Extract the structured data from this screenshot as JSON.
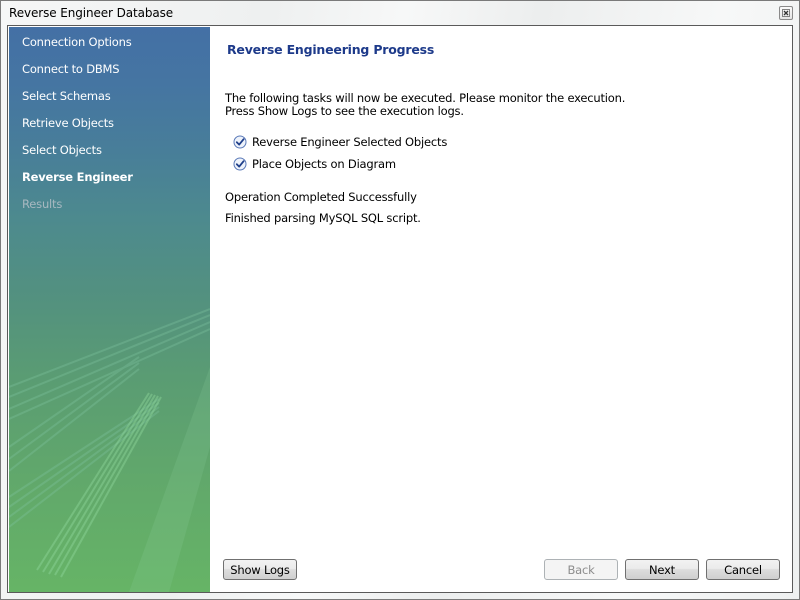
{
  "window": {
    "title": "Reverse Engineer Database",
    "close_icon": "close-x-icon"
  },
  "sidebar": {
    "items": [
      {
        "label": "Connection Options",
        "state": "done"
      },
      {
        "label": "Connect to DBMS",
        "state": "done"
      },
      {
        "label": "Select Schemas",
        "state": "done"
      },
      {
        "label": "Retrieve Objects",
        "state": "done"
      },
      {
        "label": "Select Objects",
        "state": "done"
      },
      {
        "label": "Reverse Engineer",
        "state": "active"
      },
      {
        "label": "Results",
        "state": "disabled"
      }
    ]
  },
  "main": {
    "title": "Reverse Engineering Progress",
    "description_line1": "The following tasks will now be executed. Please monitor the execution.",
    "description_line2": "Press Show Logs to see the execution logs.",
    "tasks": [
      {
        "label": "Reverse Engineer Selected Objects",
        "icon": "checkmark-icon",
        "done": true
      },
      {
        "label": "Place Objects on Diagram",
        "icon": "checkmark-icon",
        "done": true
      }
    ],
    "status": "Operation Completed Successfully",
    "detail": "Finished parsing MySQL SQL script."
  },
  "buttons": {
    "show_logs": "Show Logs",
    "back": "Back",
    "next": "Next",
    "cancel": "Cancel"
  },
  "colors": {
    "title_blue": "#1d3a8a",
    "sidebar_top": "#4470a5",
    "sidebar_bottom": "#66b466"
  }
}
